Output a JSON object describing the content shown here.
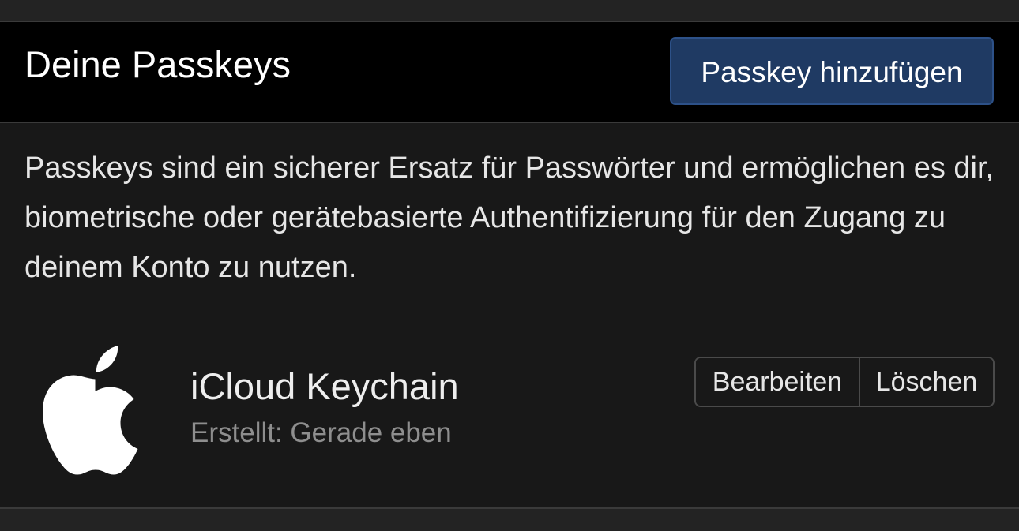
{
  "panel": {
    "title": "Deine Passkeys",
    "add_button_label": "Passkey hinzufügen",
    "description": "Passkeys sind ein sicherer Ersatz für Passwörter und ermöglichen es dir, biometrische oder gerätebasierte Authentifizierung für den Zugang zu deinem Konto zu nutzen."
  },
  "passkeys": [
    {
      "icon": "apple-logo-icon",
      "name": "iCloud Keychain",
      "meta": "Erstellt: Gerade eben",
      "edit_label": "Bearbeiten",
      "delete_label": "Löschen"
    }
  ],
  "colors": {
    "header_bg": "#000000",
    "panel_bg": "#181818",
    "primary_button": "#1f3a63",
    "muted_text": "#8e8e8e"
  }
}
